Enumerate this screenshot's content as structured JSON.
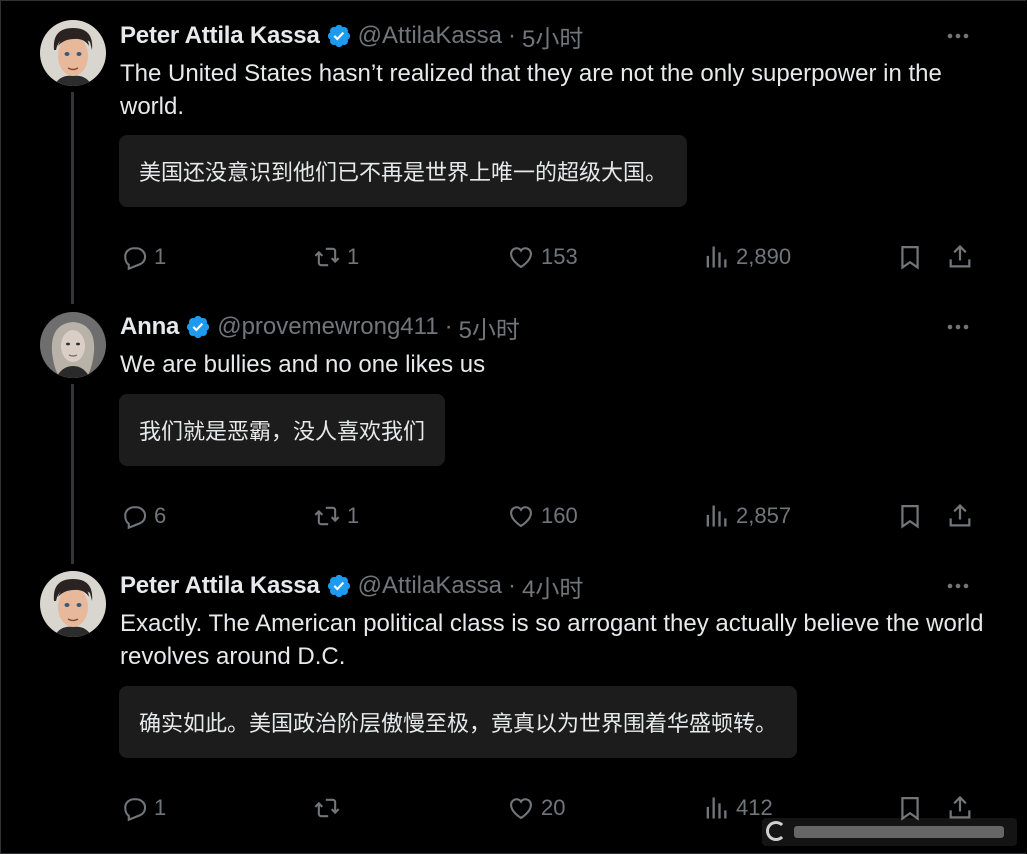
{
  "tweets": [
    {
      "name": "Peter Attila Kassa",
      "handle": "@AttilaKassa",
      "sep": "·",
      "time": "5小时",
      "text": "The United States hasn’t realized that they are not the only superpower in the world.",
      "translation": "美国还没意识到他们已不再是世界上唯一的超级大国。",
      "replies": "1",
      "retweets": "1",
      "likes": "153",
      "views": "2,890",
      "avatar_icon": "cartoon-man-avatar"
    },
    {
      "name": "Anna",
      "handle": "@provemewrong411",
      "sep": "·",
      "time": "5小时",
      "text": "We are bullies and no one likes us",
      "translation": "我们就是恶霸，没人喜欢我们",
      "replies": "6",
      "retweets": "1",
      "likes": "160",
      "views": "2,857",
      "avatar_icon": "woman-photo-avatar"
    },
    {
      "name": "Peter Attila Kassa",
      "handle": "@AttilaKassa",
      "sep": "·",
      "time": "4小时",
      "text": "Exactly. The American political class is so arrogant they actually believe the world revolves around D.C.",
      "translation": "确实如此。美国政治阶层傲慢至极，竟真以为世界围着华盛顿转。",
      "replies": "1",
      "retweets": "",
      "likes": "20",
      "views": "412",
      "avatar_icon": "cartoon-man-avatar"
    }
  ],
  "colors": {
    "background": "#000000",
    "text": "#e7e9ea",
    "muted": "#71767b",
    "verified": "#1d9bf0",
    "translate_box": "#1c1c1c"
  }
}
